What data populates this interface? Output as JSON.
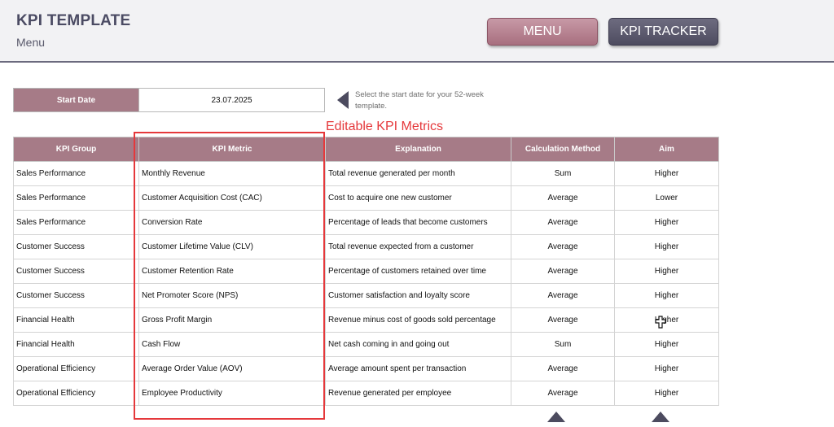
{
  "header": {
    "title": "KPI TEMPLATE",
    "subtitle": "Menu",
    "buttons": {
      "menu": "MENU",
      "kpi_tracker": "KPI TRACKER"
    }
  },
  "start_date": {
    "label": "Start Date",
    "value": "23.07.2025",
    "hint": "Select the start date for your 52-week template."
  },
  "annotation": "Editable KPI Metrics",
  "table": {
    "columns": [
      "KPI Group",
      "KPI Metric",
      "Explanation",
      "Calculation Method",
      "Aim"
    ],
    "rows": [
      [
        "Sales Performance",
        "Monthly Revenue",
        "Total revenue generated per month",
        "Sum",
        "Higher"
      ],
      [
        "Sales Performance",
        "Customer Acquisition Cost (CAC)",
        "Cost to acquire one new customer",
        "Average",
        "Lower"
      ],
      [
        "Sales Performance",
        "Conversion Rate",
        "Percentage of leads that become customers",
        "Average",
        "Higher"
      ],
      [
        "Customer Success",
        "Customer Lifetime Value (CLV)",
        "Total revenue expected from a customer",
        "Average",
        "Higher"
      ],
      [
        "Customer Success",
        "Customer Retention Rate",
        "Percentage of customers retained over time",
        "Average",
        "Higher"
      ],
      [
        "Customer Success",
        "Net Promoter Score (NPS)",
        "Customer satisfaction and loyalty score",
        "Average",
        "Higher"
      ],
      [
        "Financial Health",
        "Gross Profit Margin",
        "Revenue minus cost of goods sold percentage",
        "Average",
        "Higher"
      ],
      [
        "Financial Health",
        "Cash Flow",
        "Net cash coming in and going out",
        "Sum",
        "Higher"
      ],
      [
        "Operational Efficiency",
        "Average Order Value (AOV)",
        "Average amount spent per transaction",
        "Average",
        "Higher"
      ],
      [
        "Operational Efficiency",
        "Employee Productivity",
        "Revenue generated per employee",
        "Average",
        "Higher"
      ]
    ]
  },
  "icons": {
    "hint_arrow": "triangle-left-icon",
    "scroll_arrows": "triangle-up-icon",
    "cursor": "move-cursor-icon"
  },
  "colors": {
    "accent": "#a67b87",
    "header_dark": "#4c4b5f",
    "annotation": "#e5383b"
  }
}
